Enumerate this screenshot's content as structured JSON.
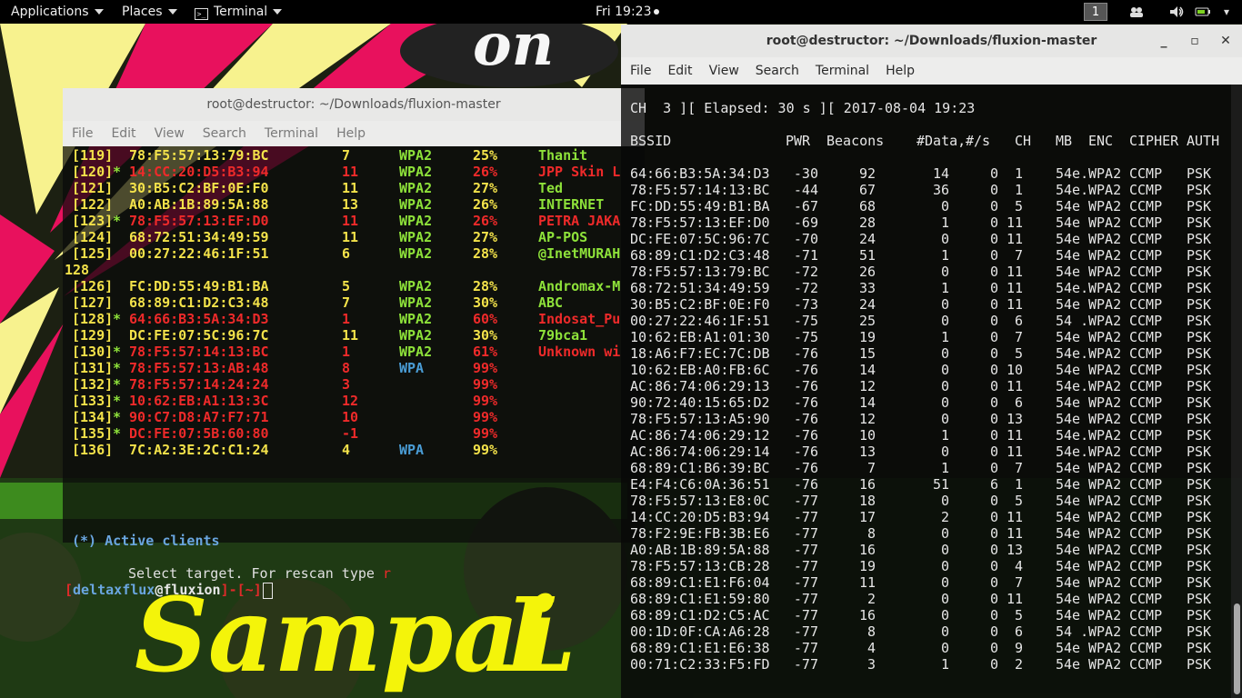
{
  "topbar": {
    "applications": "Applications",
    "places": "Places",
    "terminal": "Terminal",
    "clock": "Fri 19:23",
    "workspace": "1",
    "icons": [
      "people-icon",
      "volume-icon",
      "battery-icon",
      "power-menu-icon"
    ]
  },
  "wallpaper": {
    "text_large": "Sampai",
    "text_corner": "L"
  },
  "left_terminal": {
    "title": "root@destructor: ~/Downloads/fluxion-master",
    "menu": [
      "File",
      "Edit",
      "View",
      "Search",
      "Terminal",
      "Help"
    ],
    "rows": [
      {
        "num": "[119]",
        "star": "",
        "mac": "78:F5:57:13:79:BC",
        "ch": "7",
        "enc": "WPA2",
        "pwr": "25%",
        "essid": "Thanit",
        "hot": false
      },
      {
        "num": "[120]",
        "star": "*",
        "mac": "14:CC:20:D5:B3:94",
        "ch": "11",
        "enc": "WPA2",
        "pwr": "26%",
        "essid": "JPP Skin L",
        "hot": true
      },
      {
        "num": "[121]",
        "star": "",
        "mac": "30:B5:C2:BF:0E:F0",
        "ch": "11",
        "enc": "WPA2",
        "pwr": "27%",
        "essid": "Ted",
        "hot": false
      },
      {
        "num": "[122]",
        "star": "",
        "mac": "A0:AB:1B:89:5A:88",
        "ch": "13",
        "enc": "WPA2",
        "pwr": "26%",
        "essid": "INTERNET",
        "hot": false
      },
      {
        "num": "[123]",
        "star": "*",
        "mac": "78:F5:57:13:EF:D0",
        "ch": "11",
        "enc": "WPA2",
        "pwr": "26%",
        "essid": "PETRA JAKA",
        "hot": true
      },
      {
        "num": "[124]",
        "star": "",
        "mac": "68:72:51:34:49:59",
        "ch": "11",
        "enc": "WPA2",
        "pwr": "27%",
        "essid": "AP-POS",
        "hot": false
      },
      {
        "num": "[125]",
        "star": "",
        "mac": "00:27:22:46:1F:51",
        "ch": "6",
        "enc": "WPA2",
        "pwr": "28%",
        "essid": "@InetMURAH",
        "hot": false
      },
      {
        "num": "[126]",
        "star": "",
        "mac": "FC:DD:55:49:B1:BA",
        "ch": "5",
        "enc": "WPA2",
        "pwr": "28%",
        "essid": "Andromax-M",
        "hot": false
      },
      {
        "num": "[127]",
        "star": "",
        "mac": "68:89:C1:D2:C3:48",
        "ch": "7",
        "enc": "WPA2",
        "pwr": "30%",
        "essid": "ABC",
        "hot": false
      },
      {
        "num": "[128]",
        "star": "*",
        "mac": "64:66:B3:5A:34:D3",
        "ch": "1",
        "enc": "WPA2",
        "pwr": "60%",
        "essid": "Indosat_Pu",
        "hot": true
      },
      {
        "num": "[129]",
        "star": "",
        "mac": "DC:FE:07:5C:96:7C",
        "ch": "11",
        "enc": "WPA2",
        "pwr": "30%",
        "essid": "79bca1",
        "hot": false
      },
      {
        "num": "[130]",
        "star": "*",
        "mac": "78:F5:57:14:13:BC",
        "ch": "1",
        "enc": "WPA2",
        "pwr": "61%",
        "essid": "Unknown wi",
        "hot": true
      },
      {
        "num": "[131]",
        "star": "*",
        "mac": "78:F5:57:13:AB:48",
        "ch": "8",
        "enc": "WPA",
        "pwr": "99%",
        "essid": "",
        "hot": true
      },
      {
        "num": "[132]",
        "star": "*",
        "mac": "78:F5:57:14:24:24",
        "ch": "3",
        "enc": "",
        "pwr": "99%",
        "essid": "",
        "hot": true
      },
      {
        "num": "[133]",
        "star": "*",
        "mac": "10:62:EB:A1:13:3C",
        "ch": "12",
        "enc": "",
        "pwr": "99%",
        "essid": "",
        "hot": true
      },
      {
        "num": "[134]",
        "star": "*",
        "mac": "90:C7:D8:A7:F7:71",
        "ch": "10",
        "enc": "",
        "pwr": "99%",
        "essid": "",
        "hot": true
      },
      {
        "num": "[135]",
        "star": "*",
        "mac": "DC:FE:07:5B:60:80",
        "ch": "-1",
        "enc": "",
        "pwr": "99%",
        "essid": "",
        "hot": true
      },
      {
        "num": "[136]",
        "star": "",
        "mac": "7C:A2:3E:2C:C1:24",
        "ch": "4",
        "enc": "WPA",
        "pwr": "99%",
        "essid": "",
        "hot": false
      }
    ],
    "stray_line": "128",
    "active_clients": "(*) Active clients",
    "select_prompt": "Select target. For rescan type",
    "rescan_key": "r",
    "prompt_open": "[",
    "prompt_user": "deltaxflux",
    "prompt_at": "@",
    "prompt_host": "fluxion",
    "prompt_close": "]",
    "prompt_dash": "-",
    "prompt_dir": "[~]"
  },
  "right_terminal": {
    "title": "root@destructor: ~/Downloads/fluxion-master",
    "minimize": "_",
    "maximize": "▫",
    "close": "✕",
    "menu": [
      "File",
      "Edit",
      "View",
      "Search",
      "Terminal",
      "Help"
    ],
    "status_line": "CH  3 ][ Elapsed: 30 s ][ 2017-08-04 19:23",
    "headers": {
      "bssid": "BSSID",
      "pwr": "PWR",
      "beacons": "Beacons",
      "data": "#Data,",
      "s": "#/s",
      "ch": "CH",
      "mb": "MB",
      "enc": "ENC",
      "cipher": "CIPHER",
      "auth": "AUTH"
    },
    "rows": [
      [
        "64:66:B3:5A:34:D3",
        "-30",
        "92",
        "14",
        "0",
        "1",
        "54e.",
        "WPA2",
        "CCMP",
        "PSK"
      ],
      [
        "78:F5:57:14:13:BC",
        "-44",
        "67",
        "36",
        "0",
        "1",
        "54e.",
        "WPA2",
        "CCMP",
        "PSK"
      ],
      [
        "FC:DD:55:49:B1:BA",
        "-67",
        "68",
        "0",
        "0",
        "5",
        "54e",
        "WPA2",
        "CCMP",
        "PSK"
      ],
      [
        "78:F5:57:13:EF:D0",
        "-69",
        "28",
        "1",
        "0",
        "11",
        "54e",
        "WPA2",
        "CCMP",
        "PSK"
      ],
      [
        "DC:FE:07:5C:96:7C",
        "-70",
        "24",
        "0",
        "0",
        "11",
        "54e",
        "WPA2",
        "CCMP",
        "PSK"
      ],
      [
        "68:89:C1:D2:C3:48",
        "-71",
        "51",
        "1",
        "0",
        "7",
        "54e",
        "WPA2",
        "CCMP",
        "PSK"
      ],
      [
        "78:F5:57:13:79:BC",
        "-72",
        "26",
        "0",
        "0",
        "11",
        "54e",
        "WPA2",
        "CCMP",
        "PSK"
      ],
      [
        "68:72:51:34:49:59",
        "-72",
        "33",
        "1",
        "0",
        "11",
        "54e.",
        "WPA2",
        "CCMP",
        "PSK"
      ],
      [
        "30:B5:C2:BF:0E:F0",
        "-73",
        "24",
        "0",
        "0",
        "11",
        "54e",
        "WPA2",
        "CCMP",
        "PSK"
      ],
      [
        "00:27:22:46:1F:51",
        "-75",
        "25",
        "0",
        "0",
        "6",
        "54 .",
        "WPA2",
        "CCMP",
        "PSK"
      ],
      [
        "10:62:EB:A1:01:30",
        "-75",
        "19",
        "1",
        "0",
        "7",
        "54e",
        "WPA2",
        "CCMP",
        "PSK"
      ],
      [
        "18:A6:F7:EC:7C:DB",
        "-76",
        "15",
        "0",
        "0",
        "5",
        "54e.",
        "WPA2",
        "CCMP",
        "PSK"
      ],
      [
        "10:62:EB:A0:FB:6C",
        "-76",
        "14",
        "0",
        "0",
        "10",
        "54e",
        "WPA2",
        "CCMP",
        "PSK"
      ],
      [
        "AC:86:74:06:29:13",
        "-76",
        "12",
        "0",
        "0",
        "11",
        "54e.",
        "WPA2",
        "CCMP",
        "PSK"
      ],
      [
        "90:72:40:15:65:D2",
        "-76",
        "14",
        "0",
        "0",
        "6",
        "54e",
        "WPA2",
        "CCMP",
        "PSK"
      ],
      [
        "78:F5:57:13:A5:90",
        "-76",
        "12",
        "0",
        "0",
        "13",
        "54e",
        "WPA2",
        "CCMP",
        "PSK"
      ],
      [
        "AC:86:74:06:29:12",
        "-76",
        "10",
        "1",
        "0",
        "11",
        "54e.",
        "WPA2",
        "CCMP",
        "PSK"
      ],
      [
        "AC:86:74:06:29:14",
        "-76",
        "13",
        "0",
        "0",
        "11",
        "54e.",
        "WPA2",
        "CCMP",
        "PSK"
      ],
      [
        "68:89:C1:B6:39:BC",
        "-76",
        "7",
        "1",
        "0",
        "7",
        "54e",
        "WPA2",
        "CCMP",
        "PSK"
      ],
      [
        "E4:F4:C6:0A:36:51",
        "-76",
        "16",
        "51",
        "6",
        "1",
        "54e",
        "WPA2",
        "CCMP",
        "PSK"
      ],
      [
        "78:F5:57:13:E8:0C",
        "-77",
        "18",
        "0",
        "0",
        "5",
        "54e",
        "WPA2",
        "CCMP",
        "PSK"
      ],
      [
        "14:CC:20:D5:B3:94",
        "-77",
        "17",
        "2",
        "0",
        "11",
        "54e",
        "WPA2",
        "CCMP",
        "PSK"
      ],
      [
        "78:F2:9E:FB:3B:E6",
        "-77",
        "8",
        "0",
        "0",
        "11",
        "54e",
        "WPA2",
        "CCMP",
        "PSK"
      ],
      [
        "A0:AB:1B:89:5A:88",
        "-77",
        "16",
        "0",
        "0",
        "13",
        "54e",
        "WPA2",
        "CCMP",
        "PSK"
      ],
      [
        "78:F5:57:13:CB:28",
        "-77",
        "19",
        "0",
        "0",
        "4",
        "54e",
        "WPA2",
        "CCMP",
        "PSK"
      ],
      [
        "68:89:C1:E1:F6:04",
        "-77",
        "11",
        "0",
        "0",
        "7",
        "54e",
        "WPA2",
        "CCMP",
        "PSK"
      ],
      [
        "68:89:C1:E1:59:80",
        "-77",
        "2",
        "0",
        "0",
        "11",
        "54e",
        "WPA2",
        "CCMP",
        "PSK"
      ],
      [
        "68:89:C1:D2:C5:AC",
        "-77",
        "16",
        "0",
        "0",
        "5",
        "54e",
        "WPA2",
        "CCMP",
        "PSK"
      ],
      [
        "00:1D:0F:CA:A6:28",
        "-77",
        "8",
        "0",
        "0",
        "6",
        "54 .",
        "WPA2",
        "CCMP",
        "PSK"
      ],
      [
        "68:89:C1:E1:E6:38",
        "-77",
        "4",
        "0",
        "0",
        "9",
        "54e",
        "WPA2",
        "CCMP",
        "PSK"
      ],
      [
        "00:71:C2:33:F5:FD",
        "-77",
        "3",
        "1",
        "0",
        "2",
        "54e",
        "WPA2",
        "CCMP",
        "PSK"
      ]
    ]
  },
  "colors": {
    "num_yellow": "#f3e24a",
    "green": "#8ee23a",
    "red": "#ee2a2a",
    "blue_enc": "#4a9dd6",
    "prompt_blue": "#6aa6e0",
    "prompt_red": "#e02a2a"
  }
}
